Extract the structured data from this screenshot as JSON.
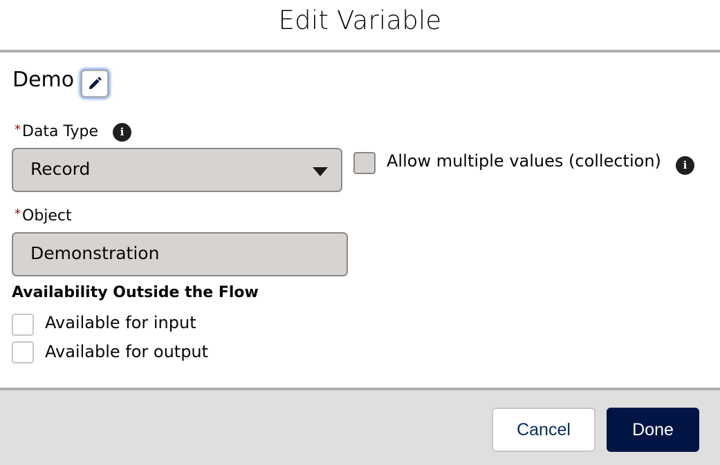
{
  "modal": {
    "title": "Edit Variable",
    "variable_name": "Demo",
    "edit_icon": "pencil-icon"
  },
  "form": {
    "data_type": {
      "required_marker": "*",
      "label": "Data Type",
      "info_icon": "info-icon",
      "selected_value": "Record",
      "dropdown_icon": "triangle-down-icon"
    },
    "collection": {
      "label": "Allow multiple values (collection)",
      "checked": false,
      "info_icon": "info-icon"
    },
    "object": {
      "required_marker": "*",
      "label": "Object",
      "value": "Demonstration"
    },
    "availability": {
      "heading": "Availability Outside the Flow",
      "options": [
        {
          "label": "Available for input",
          "checked": false
        },
        {
          "label": "Available for output",
          "checked": false
        }
      ]
    }
  },
  "footer": {
    "cancel_label": "Cancel",
    "done_label": "Done"
  },
  "colors": {
    "primary_button": "#001544",
    "focus_ring": "#6f9be8",
    "required": "#8b0f0f",
    "divider": "#b0adab",
    "footer_bg": "#e0dfdf"
  }
}
